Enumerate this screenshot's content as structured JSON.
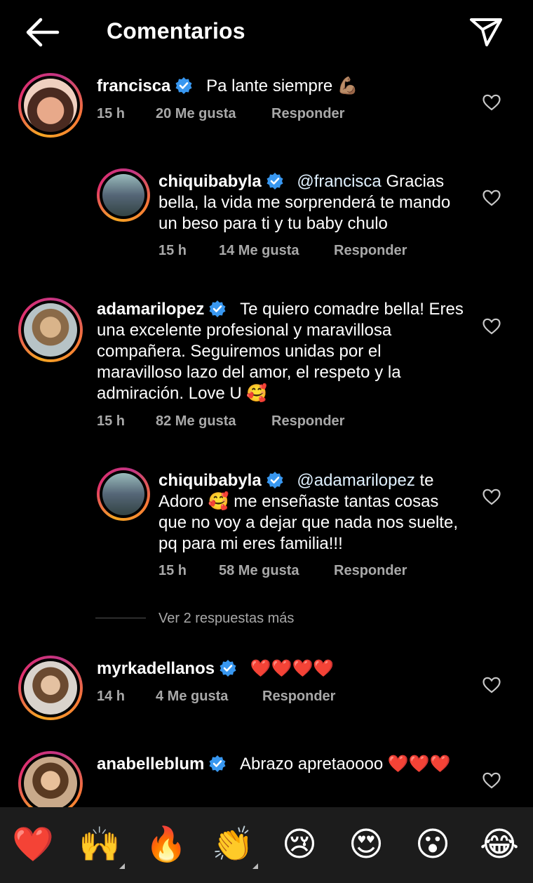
{
  "header": {
    "title": "Comentarios"
  },
  "comments": [
    {
      "username": "francisca",
      "text": "Pa lante siempre 💪🏽",
      "time": "15 h",
      "likes": "20 Me gusta",
      "reply": "Responder"
    },
    {
      "username": "chiquibabyla",
      "mention": "@francisca",
      "text": "Gracias bella, la vida me sorprenderá te mando un beso para ti y tu baby chulo",
      "time": "15 h",
      "likes": "14 Me gusta",
      "reply": "Responder"
    },
    {
      "username": "adamarilopez",
      "text": "Te quiero comadre bella! Eres una excelente profesional y maravillosa compañera. Seguiremos unidas por el maravilloso lazo del amor, el respeto y la admiración. Love U 🥰",
      "time": "15 h",
      "likes": "82 Me gusta",
      "reply": "Responder"
    },
    {
      "username": "chiquibabyla",
      "mention": "@adamarilopez",
      "text": "te Adoro 🥰 me enseñaste tantas cosas que no voy a dejar que nada nos suelte, pq para mi eres familia!!!",
      "time": "15 h",
      "likes": "58 Me gusta",
      "reply": "Responder"
    },
    {
      "username": "myrkadellanos",
      "text": "❤️❤️❤️❤️",
      "time": "14 h",
      "likes": "4 Me gusta",
      "reply": "Responder"
    },
    {
      "username": "anabelleblum",
      "text": "Abrazo apretaoooo ❤️❤️❤️"
    }
  ],
  "view_more": "Ver 2 respuestas más",
  "emoji_bar": [
    "❤️",
    "🙌",
    "🔥",
    "👏",
    "😢",
    "😍",
    "😮",
    "😂"
  ],
  "colors": {
    "verified": "#3897f0",
    "background": "#000000",
    "muted": "#a8a8a8"
  },
  "icons": [
    "back-arrow-icon",
    "send-icon",
    "verified-badge-icon",
    "heart-outline-icon"
  ]
}
